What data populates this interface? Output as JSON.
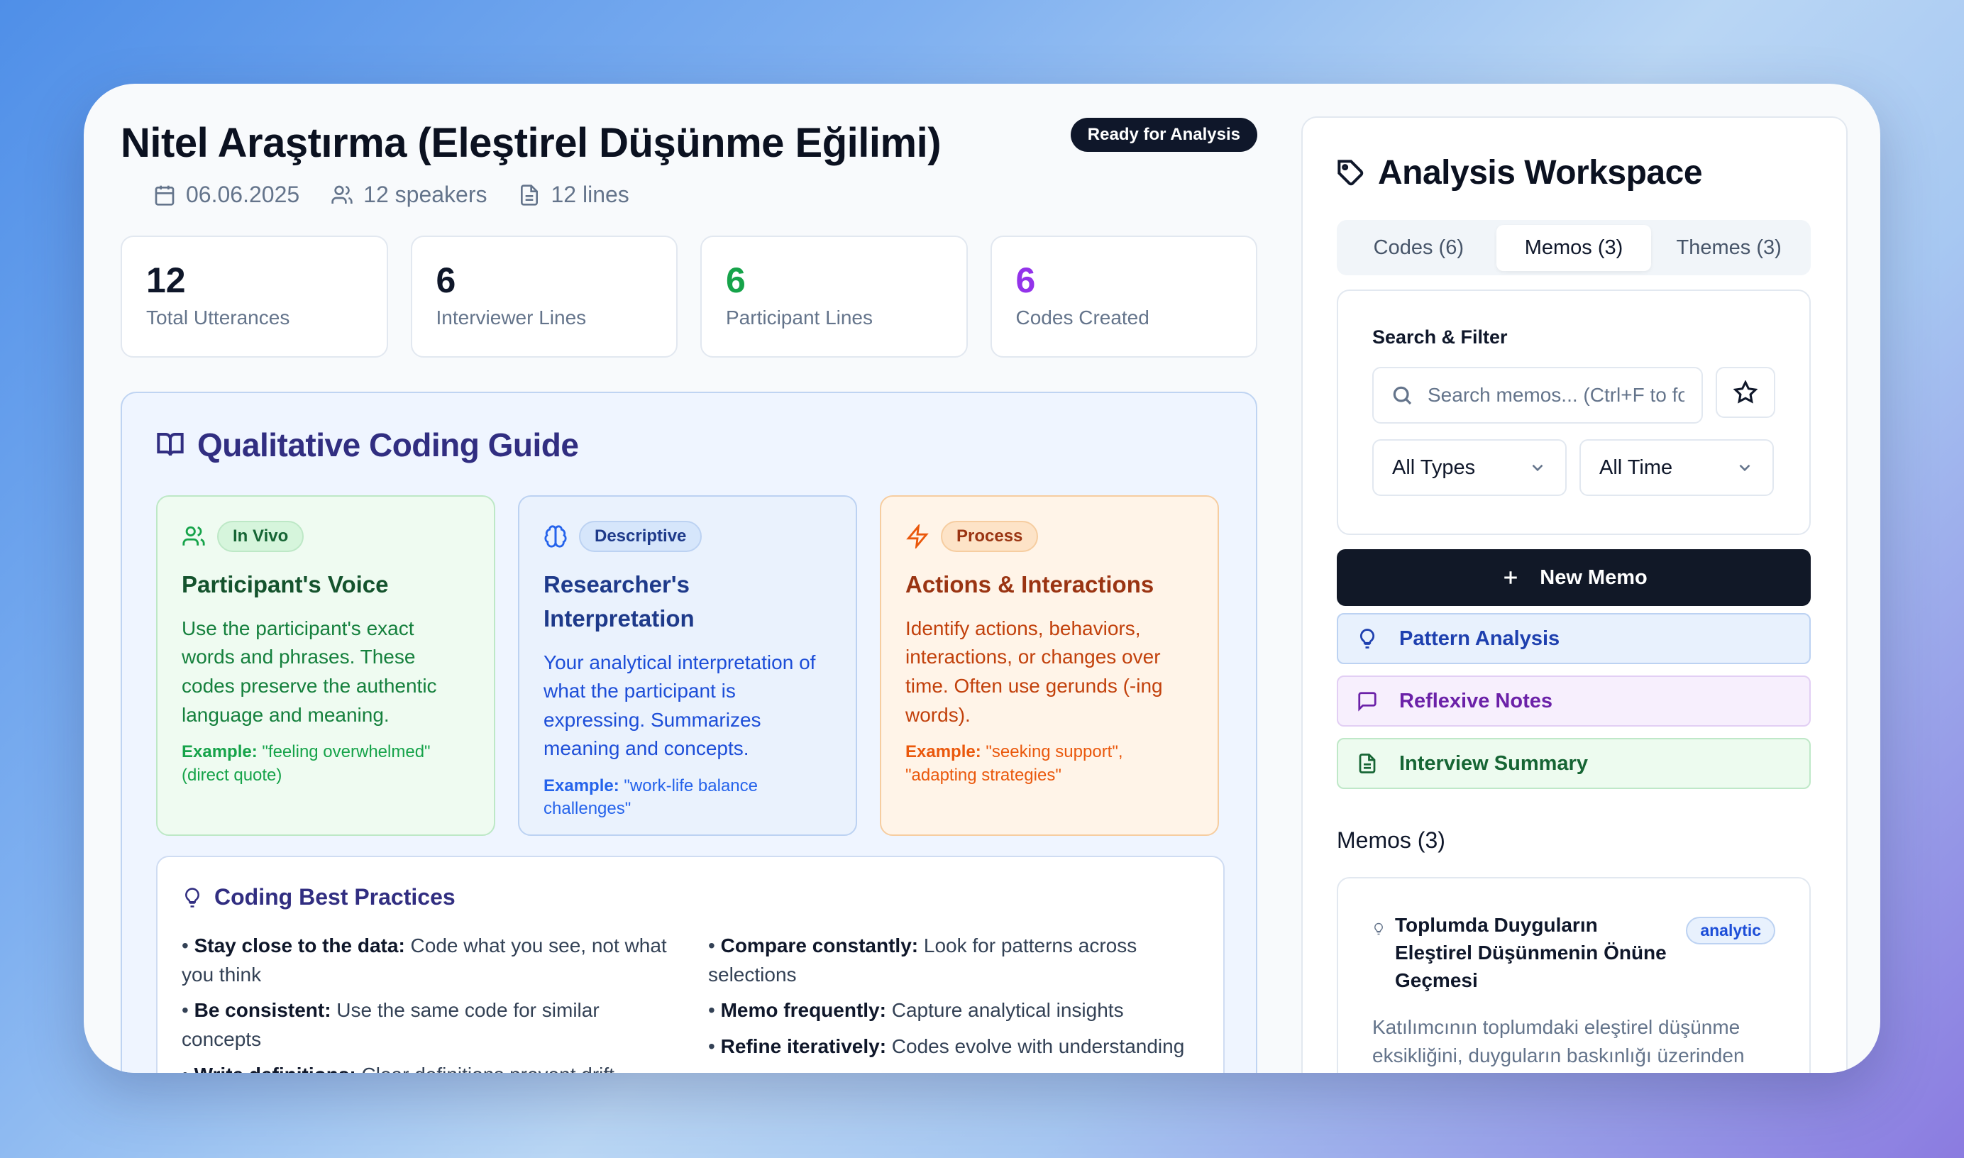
{
  "header": {
    "title": "Nitel Araştırma (Eleştirel Düşünme Eğilimi)",
    "status_badge": "Ready for Analysis",
    "date": "06.06.2025",
    "speakers": "12 speakers",
    "lines": "12 lines"
  },
  "stats": [
    {
      "value": "12",
      "label": "Total Utterances",
      "color": "#0f172a"
    },
    {
      "value": "6",
      "label": "Interviewer Lines",
      "color": "#0f172a"
    },
    {
      "value": "6",
      "label": "Participant Lines",
      "color": "#16a34a"
    },
    {
      "value": "6",
      "label": "Codes Created",
      "color": "#9333ea"
    }
  ],
  "guide": {
    "title": "Qualitative Coding Guide",
    "cards": [
      {
        "tag": "In Vivo",
        "title": "Participant's Voice",
        "body": "Use the participant's exact words and phrases. These codes preserve the authentic language and meaning.",
        "example_label": "Example:",
        "example_text": "\"feeling overwhelmed\" (direct quote)",
        "icon": "users-icon"
      },
      {
        "tag": "Descriptive",
        "title": "Researcher's Interpretation",
        "body": "Your analytical interpretation of what the participant is expressing. Summarizes meaning and concepts.",
        "example_label": "Example:",
        "example_text": "\"work-life balance challenges\"",
        "icon": "brain-icon"
      },
      {
        "tag": "Process",
        "title": "Actions & Interactions",
        "body": "Identify actions, behaviors, interactions, or changes over time. Often use gerunds (-ing words).",
        "example_label": "Example:",
        "example_text": "\"seeking support\", \"adapting strategies\"",
        "icon": "zap-icon"
      }
    ],
    "practices": {
      "title": "Coding Best Practices",
      "left": [
        {
          "bold": "Stay close to the data:",
          "text": " Code what you see, not what you think"
        },
        {
          "bold": "Be consistent:",
          "text": " Use the same code for similar concepts"
        },
        {
          "bold": "Write definitions:",
          "text": " Clear definitions prevent drift"
        }
      ],
      "right": [
        {
          "bold": "Compare constantly:",
          "text": " Look for patterns across selections"
        },
        {
          "bold": "Memo frequently:",
          "text": " Capture analytical insights"
        },
        {
          "bold": "Refine iteratively:",
          "text": " Codes evolve with understanding"
        }
      ]
    }
  },
  "workspace": {
    "title": "Analysis Workspace",
    "tabs": [
      {
        "label": "Codes (6)",
        "active": false
      },
      {
        "label": "Memos (3)",
        "active": true
      },
      {
        "label": "Themes (3)",
        "active": false
      }
    ],
    "filter": {
      "label": "Search & Filter",
      "search_placeholder": "Search memos... (Ctrl+F to focus)",
      "type_select": "All Types",
      "time_select": "All Time"
    },
    "new_memo_label": "New Memo",
    "templates": [
      {
        "label": "Pattern Analysis",
        "icon": "lightbulb-icon"
      },
      {
        "label": "Reflexive Notes",
        "icon": "message-square-icon"
      },
      {
        "label": "Interview Summary",
        "icon": "file-text-icon"
      }
    ],
    "memos_heading": "Memos (3)",
    "memos": [
      {
        "title": "Toplumda Duyguların Eleştirel Düşünmenin Önüne Geçmesi",
        "tag": "analytic",
        "preview": "Katılımcının toplumdaki eleştirel düşünme eksikliğini, duyguların baskınlığı üzerinden ifade etmesi önemli. Bu tür gözlemler,..."
      }
    ]
  }
}
